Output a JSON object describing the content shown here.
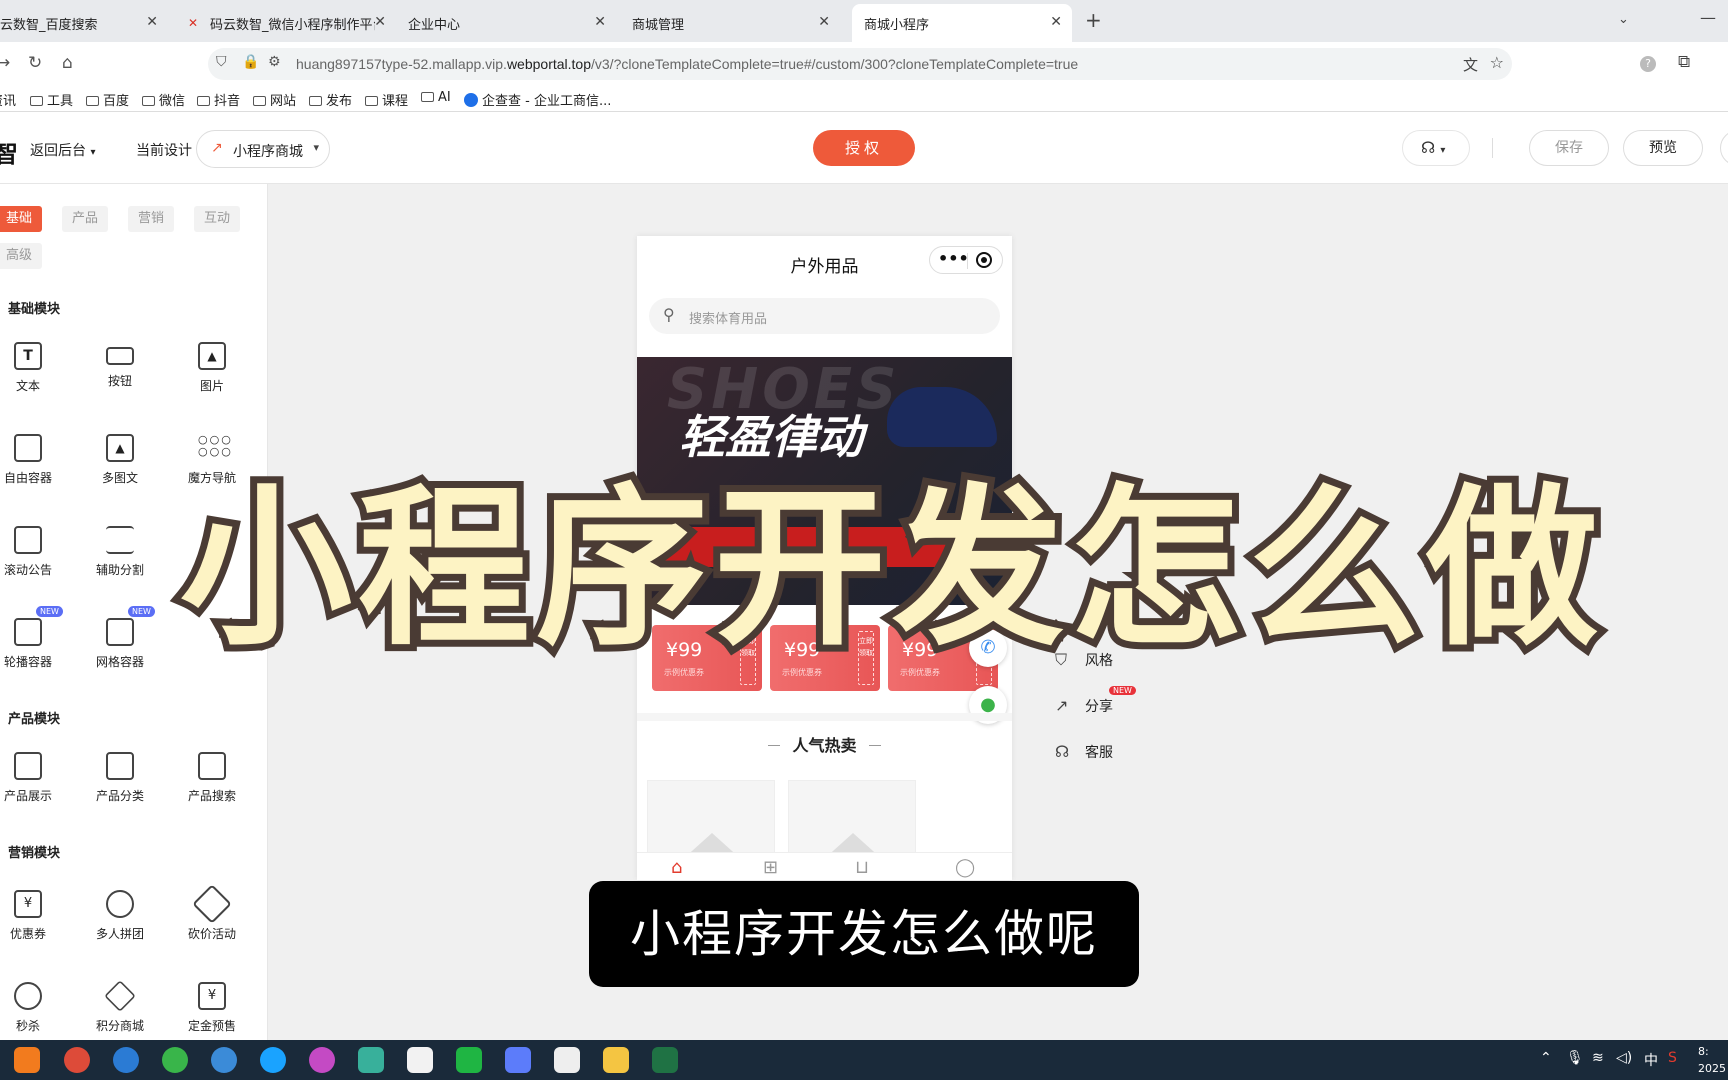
{
  "browser": {
    "tabs": [
      {
        "title": "云数智_百度搜索"
      },
      {
        "title": "码云数智_微信小程序制作平台_"
      },
      {
        "title": "企业中心"
      },
      {
        "title": "商城管理"
      },
      {
        "title": "商城小程序"
      }
    ],
    "url_prefix": "huang897157type-52.mallapp.vip.",
    "url_domain": "webportal.top",
    "url_suffix": "/v3/?cloneTemplateComplete=true#/custom/300?cloneTemplateComplete=true",
    "bookmarks": [
      "资讯",
      "工具",
      "百度",
      "微信",
      "抖音",
      "网站",
      "发布",
      "课程",
      "AI",
      "企查查 - 企业工商信..."
    ]
  },
  "header": {
    "logo": "智",
    "back": "返回后台",
    "current_design_label": "当前设计",
    "design_select": "小程序商城",
    "auth_button": "授权",
    "save_button": "保存",
    "preview_button": "预览"
  },
  "left_panel": {
    "categories": [
      "基础",
      "产品",
      "营销",
      "互动",
      "高级"
    ],
    "sections": {
      "basic": "基础模块",
      "product": "产品模块",
      "marketing": "营销模块"
    },
    "basic_items": [
      "文本",
      "按钮",
      "图片",
      "自由容器",
      "多图文",
      "魔方导航",
      "滚动公告",
      "辅助分割",
      "轮播容器",
      "网格容器"
    ],
    "product_items": [
      "产品展示",
      "产品分类",
      "产品搜索"
    ],
    "marketing_items": [
      "优惠券",
      "多人拼团",
      "砍价活动",
      "秒杀",
      "积分商城",
      "定金预售"
    ],
    "new_badge": "NEW"
  },
  "phone": {
    "title": "户外用品",
    "search_placeholder": "搜索体育用品",
    "banner_bg_word": "SHOES",
    "banner_slogan": "轻盈律动",
    "coupons": [
      {
        "amount": "¥99",
        "desc": "示例优惠券",
        "stub": "立即领取"
      },
      {
        "amount": "¥99",
        "desc": "示例优惠券",
        "stub": "立即领取"
      },
      {
        "amount": "¥99",
        "desc": "示例优惠券",
        "stub": "立即领取"
      }
    ],
    "hot_title": "人气热卖"
  },
  "right_options": {
    "style": "风格",
    "share": "分享",
    "service": "客服",
    "new_badge": "NEW"
  },
  "overlay": {
    "big_title": "小程序开发怎么做",
    "subtitle": "小程序开发怎么做呢"
  },
  "taskbar": {
    "ime": "中",
    "clock_time": "8:",
    "clock_date": "2025"
  },
  "colors": {
    "accent": "#ee5a3a",
    "overlay_fill": "#fdf3c4",
    "overlay_stroke": "#4a3b34"
  }
}
